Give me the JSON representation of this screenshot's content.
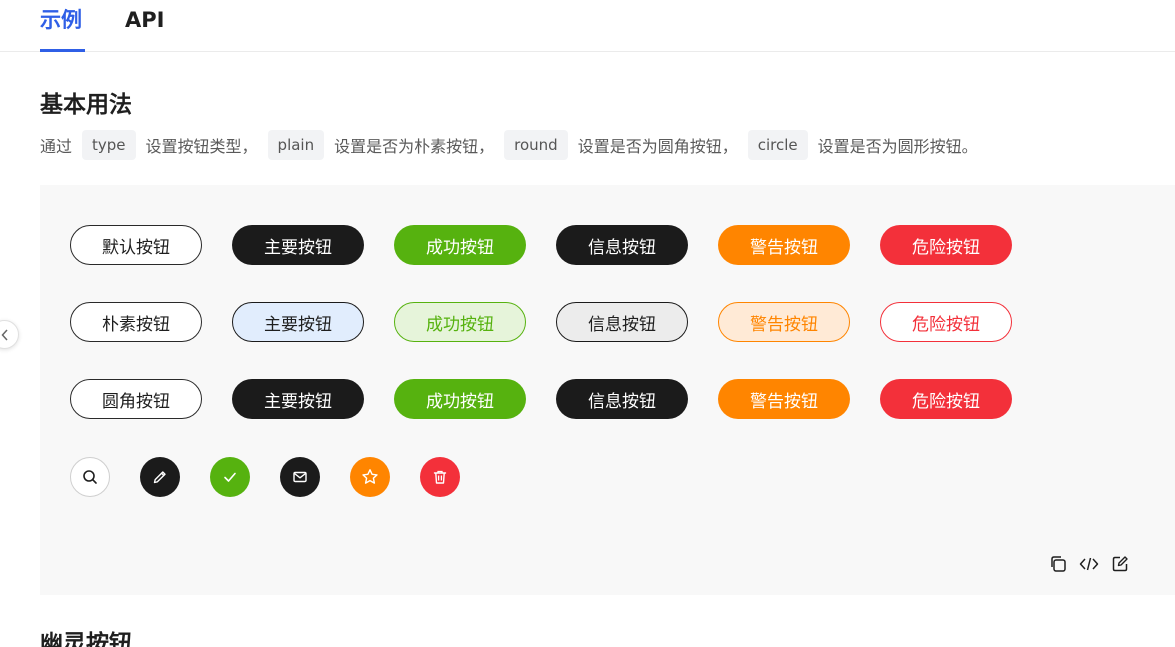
{
  "tabs": [
    {
      "label": "示例",
      "active": true
    },
    {
      "label": "API",
      "active": false
    }
  ],
  "section": {
    "title": "基本用法",
    "desc": {
      "t0": "通过",
      "c0": "type",
      "t1": "设置按钮类型，",
      "c1": "plain",
      "t2": "设置是否为朴素按钮，",
      "c2": "round",
      "t3": "设置是否为圆角按钮，",
      "c3": "circle",
      "t4": "设置是否为圆形按钮。"
    }
  },
  "colors": {
    "accent": "#2f5fe6",
    "primary": "#1b1b1b",
    "success": "#56b20f",
    "info": "#1b1b1b",
    "warning": "#ff8500",
    "danger": "#f3303a"
  },
  "rows": [
    {
      "variant": "solid",
      "labels": [
        "默认按钮",
        "主要按钮",
        "成功按钮",
        "信息按钮",
        "警告按钮",
        "危险按钮"
      ]
    },
    {
      "variant": "plain",
      "labels": [
        "朴素按钮",
        "主要按钮",
        "成功按钮",
        "信息按钮",
        "警告按钮",
        "危险按钮"
      ]
    },
    {
      "variant": "round",
      "labels": [
        "圆角按钮",
        "主要按钮",
        "成功按钮",
        "信息按钮",
        "警告按钮",
        "危险按钮"
      ]
    }
  ],
  "circle_icons": [
    "search-icon",
    "edit-icon",
    "check-icon",
    "mail-icon",
    "star-icon",
    "delete-icon"
  ],
  "tools": [
    "copy-icon",
    "code-icon",
    "edit-external-icon"
  ],
  "next_section_title": "幽灵按钮"
}
